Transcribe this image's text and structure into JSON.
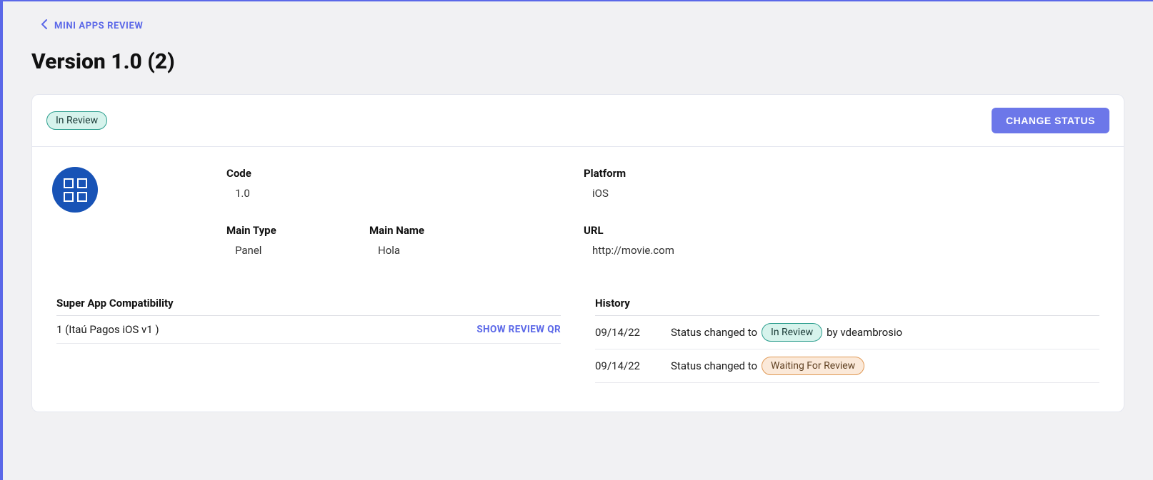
{
  "breadcrumb": {
    "label": "MINI APPS REVIEW"
  },
  "page_title": "Version 1.0 (2)",
  "status_badge": "In Review",
  "actions": {
    "change_status": "CHANGE STATUS"
  },
  "details": {
    "code": {
      "label": "Code",
      "value": "1.0"
    },
    "platform": {
      "label": "Platform",
      "value": "iOS"
    },
    "main_type": {
      "label": "Main Type",
      "value": "Panel"
    },
    "main_name": {
      "label": "Main Name",
      "value": "Hola"
    },
    "url": {
      "label": "URL",
      "value": "http://movie.com"
    }
  },
  "compat": {
    "heading": "Super App Compatibility",
    "rows": [
      {
        "label": "1 (Itaú Pagos iOS v1 )",
        "action": "SHOW REVIEW QR"
      }
    ]
  },
  "history": {
    "heading": "History",
    "rows": [
      {
        "date": "09/14/22",
        "prefix": "Status changed to ",
        "badge": "In Review",
        "badge_variant": "in-review",
        "suffix": " by vdeambrosio"
      },
      {
        "date": "09/14/22",
        "prefix": "Status changed to ",
        "badge": "Waiting For Review",
        "badge_variant": "waiting",
        "suffix": ""
      }
    ]
  }
}
